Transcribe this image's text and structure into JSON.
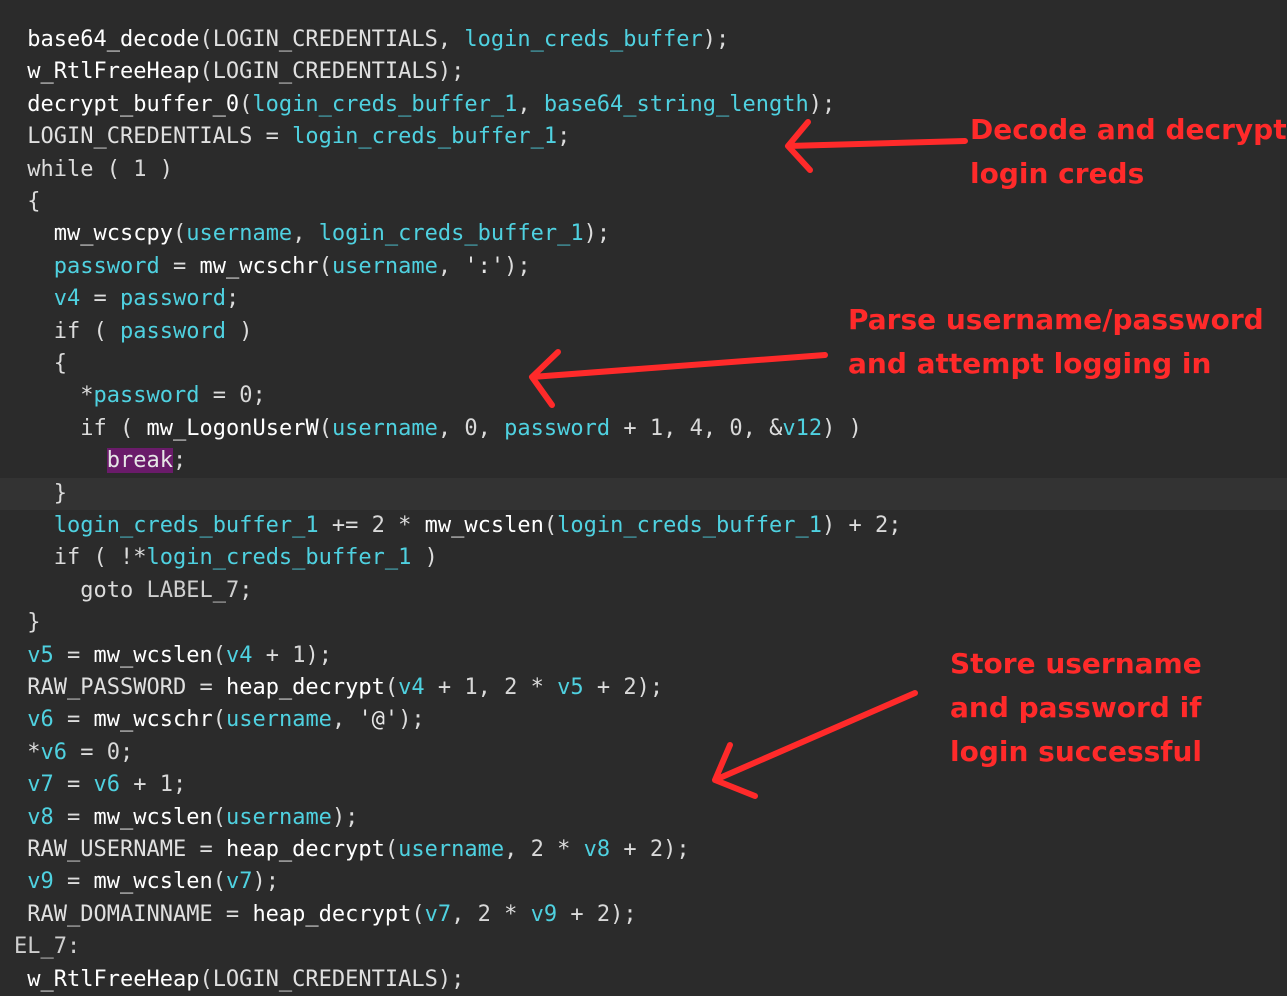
{
  "code_lines": [
    {
      "indent": 1,
      "tokens": [
        {
          "t": "base64_decode",
          "c": "fn"
        },
        {
          "t": "(",
          "c": "pn"
        },
        {
          "t": "LOGIN_CREDENTIALS",
          "c": "glob"
        },
        {
          "t": ", ",
          "c": "pn"
        },
        {
          "t": "login_creds_buffer",
          "c": "id"
        },
        {
          "t": ");",
          "c": "pn"
        }
      ]
    },
    {
      "indent": 1,
      "tokens": [
        {
          "t": "w_RtlFreeHeap",
          "c": "fn"
        },
        {
          "t": "(",
          "c": "pn"
        },
        {
          "t": "LOGIN_CREDENTIALS",
          "c": "glob"
        },
        {
          "t": ");",
          "c": "pn"
        }
      ]
    },
    {
      "indent": 1,
      "tokens": [
        {
          "t": "decrypt_buffer_0",
          "c": "fn"
        },
        {
          "t": "(",
          "c": "pn"
        },
        {
          "t": "login_creds_buffer_1",
          "c": "id"
        },
        {
          "t": ", ",
          "c": "pn"
        },
        {
          "t": "base64_string_length",
          "c": "id"
        },
        {
          "t": ");",
          "c": "pn"
        }
      ]
    },
    {
      "indent": 1,
      "tokens": [
        {
          "t": "LOGIN_CREDENTIALS",
          "c": "glob"
        },
        {
          "t": " = ",
          "c": "pn"
        },
        {
          "t": "login_creds_buffer_1",
          "c": "id"
        },
        {
          "t": ";",
          "c": "pn"
        }
      ]
    },
    {
      "indent": 1,
      "tokens": [
        {
          "t": "while",
          "c": "kw"
        },
        {
          "t": " ( ",
          "c": "pn"
        },
        {
          "t": "1",
          "c": "num"
        },
        {
          "t": " )",
          "c": "pn"
        }
      ]
    },
    {
      "indent": 1,
      "tokens": [
        {
          "t": "{",
          "c": "pn"
        }
      ]
    },
    {
      "indent": 3,
      "tokens": [
        {
          "t": "mw_wcscpy",
          "c": "fn"
        },
        {
          "t": "(",
          "c": "pn"
        },
        {
          "t": "username",
          "c": "id"
        },
        {
          "t": ", ",
          "c": "pn"
        },
        {
          "t": "login_creds_buffer_1",
          "c": "id"
        },
        {
          "t": ");",
          "c": "pn"
        }
      ]
    },
    {
      "indent": 3,
      "tokens": [
        {
          "t": "password",
          "c": "id"
        },
        {
          "t": " = ",
          "c": "pn"
        },
        {
          "t": "mw_wcschr",
          "c": "fn"
        },
        {
          "t": "(",
          "c": "pn"
        },
        {
          "t": "username",
          "c": "id"
        },
        {
          "t": ", ",
          "c": "pn"
        },
        {
          "t": "':'",
          "c": "str"
        },
        {
          "t": ");",
          "c": "pn"
        }
      ]
    },
    {
      "indent": 3,
      "tokens": [
        {
          "t": "v4",
          "c": "id"
        },
        {
          "t": " = ",
          "c": "pn"
        },
        {
          "t": "password",
          "c": "id"
        },
        {
          "t": ";",
          "c": "pn"
        }
      ]
    },
    {
      "indent": 3,
      "tokens": [
        {
          "t": "if",
          "c": "kw"
        },
        {
          "t": " ( ",
          "c": "pn"
        },
        {
          "t": "password",
          "c": "id"
        },
        {
          "t": " )",
          "c": "pn"
        }
      ]
    },
    {
      "indent": 3,
      "tokens": [
        {
          "t": "{",
          "c": "pn"
        }
      ]
    },
    {
      "indent": 5,
      "tokens": [
        {
          "t": "*",
          "c": "pn"
        },
        {
          "t": "password",
          "c": "id"
        },
        {
          "t": " = ",
          "c": "pn"
        },
        {
          "t": "0",
          "c": "num"
        },
        {
          "t": ";",
          "c": "pn"
        }
      ]
    },
    {
      "indent": 5,
      "tokens": [
        {
          "t": "if",
          "c": "kw"
        },
        {
          "t": " ( ",
          "c": "pn"
        },
        {
          "t": "mw_LogonUserW",
          "c": "fn"
        },
        {
          "t": "(",
          "c": "pn"
        },
        {
          "t": "username",
          "c": "id"
        },
        {
          "t": ", ",
          "c": "pn"
        },
        {
          "t": "0",
          "c": "num"
        },
        {
          "t": ", ",
          "c": "pn"
        },
        {
          "t": "password",
          "c": "id"
        },
        {
          "t": " + ",
          "c": "pn"
        },
        {
          "t": "1",
          "c": "num"
        },
        {
          "t": ", ",
          "c": "pn"
        },
        {
          "t": "4",
          "c": "num"
        },
        {
          "t": ", ",
          "c": "pn"
        },
        {
          "t": "0",
          "c": "num"
        },
        {
          "t": ", ",
          "c": "pn"
        },
        {
          "t": "&",
          "c": "pn"
        },
        {
          "t": "v12",
          "c": "id"
        },
        {
          "t": ") )",
          "c": "pn"
        }
      ]
    },
    {
      "indent": 7,
      "tokens": [
        {
          "t": "break",
          "c": "break"
        },
        {
          "t": ";",
          "c": "pn"
        }
      ]
    },
    {
      "indent": 3,
      "highlight": true,
      "tokens": [
        {
          "t": "}",
          "c": "pn"
        }
      ]
    },
    {
      "indent": 3,
      "tokens": [
        {
          "t": "login_creds_buffer_1",
          "c": "id"
        },
        {
          "t": " += ",
          "c": "pn"
        },
        {
          "t": "2",
          "c": "num"
        },
        {
          "t": " * ",
          "c": "pn"
        },
        {
          "t": "mw_wcslen",
          "c": "fn"
        },
        {
          "t": "(",
          "c": "pn"
        },
        {
          "t": "login_creds_buffer_1",
          "c": "id"
        },
        {
          "t": ") + ",
          "c": "pn"
        },
        {
          "t": "2",
          "c": "num"
        },
        {
          "t": ";",
          "c": "pn"
        }
      ]
    },
    {
      "indent": 3,
      "tokens": [
        {
          "t": "if",
          "c": "kw"
        },
        {
          "t": " ( !*",
          "c": "pn"
        },
        {
          "t": "login_creds_buffer_1",
          "c": "id"
        },
        {
          "t": " )",
          "c": "pn"
        }
      ]
    },
    {
      "indent": 5,
      "tokens": [
        {
          "t": "goto",
          "c": "kw"
        },
        {
          "t": " ",
          "c": "pn"
        },
        {
          "t": "LABEL_7",
          "c": "label"
        },
        {
          "t": ";",
          "c": "pn"
        }
      ]
    },
    {
      "indent": 1,
      "tokens": [
        {
          "t": "}",
          "c": "pn"
        }
      ]
    },
    {
      "indent": 1,
      "tokens": [
        {
          "t": "v5",
          "c": "id"
        },
        {
          "t": " = ",
          "c": "pn"
        },
        {
          "t": "mw_wcslen",
          "c": "fn"
        },
        {
          "t": "(",
          "c": "pn"
        },
        {
          "t": "v4",
          "c": "id"
        },
        {
          "t": " + ",
          "c": "pn"
        },
        {
          "t": "1",
          "c": "num"
        },
        {
          "t": ");",
          "c": "pn"
        }
      ]
    },
    {
      "indent": 1,
      "tokens": [
        {
          "t": "RAW_PASSWORD",
          "c": "glob"
        },
        {
          "t": " = ",
          "c": "pn"
        },
        {
          "t": "heap_decrypt",
          "c": "fn"
        },
        {
          "t": "(",
          "c": "pn"
        },
        {
          "t": "v4",
          "c": "id"
        },
        {
          "t": " + ",
          "c": "pn"
        },
        {
          "t": "1",
          "c": "num"
        },
        {
          "t": ", ",
          "c": "pn"
        },
        {
          "t": "2",
          "c": "num"
        },
        {
          "t": " * ",
          "c": "pn"
        },
        {
          "t": "v5",
          "c": "id"
        },
        {
          "t": " + ",
          "c": "pn"
        },
        {
          "t": "2",
          "c": "num"
        },
        {
          "t": ");",
          "c": "pn"
        }
      ]
    },
    {
      "indent": 1,
      "tokens": [
        {
          "t": "v6",
          "c": "id"
        },
        {
          "t": " = ",
          "c": "pn"
        },
        {
          "t": "mw_wcschr",
          "c": "fn"
        },
        {
          "t": "(",
          "c": "pn"
        },
        {
          "t": "username",
          "c": "id"
        },
        {
          "t": ", ",
          "c": "pn"
        },
        {
          "t": "'@'",
          "c": "str"
        },
        {
          "t": ");",
          "c": "pn"
        }
      ]
    },
    {
      "indent": 1,
      "tokens": [
        {
          "t": "*",
          "c": "pn"
        },
        {
          "t": "v6",
          "c": "id"
        },
        {
          "t": " = ",
          "c": "pn"
        },
        {
          "t": "0",
          "c": "num"
        },
        {
          "t": ";",
          "c": "pn"
        }
      ]
    },
    {
      "indent": 1,
      "tokens": [
        {
          "t": "v7",
          "c": "id"
        },
        {
          "t": " = ",
          "c": "pn"
        },
        {
          "t": "v6",
          "c": "id"
        },
        {
          "t": " + ",
          "c": "pn"
        },
        {
          "t": "1",
          "c": "num"
        },
        {
          "t": ";",
          "c": "pn"
        }
      ]
    },
    {
      "indent": 1,
      "tokens": [
        {
          "t": "v8",
          "c": "id"
        },
        {
          "t": " = ",
          "c": "pn"
        },
        {
          "t": "mw_wcslen",
          "c": "fn"
        },
        {
          "t": "(",
          "c": "pn"
        },
        {
          "t": "username",
          "c": "id"
        },
        {
          "t": ");",
          "c": "pn"
        }
      ]
    },
    {
      "indent": 1,
      "tokens": [
        {
          "t": "RAW_USERNAME",
          "c": "glob"
        },
        {
          "t": " = ",
          "c": "pn"
        },
        {
          "t": "heap_decrypt",
          "c": "fn"
        },
        {
          "t": "(",
          "c": "pn"
        },
        {
          "t": "username",
          "c": "id"
        },
        {
          "t": ", ",
          "c": "pn"
        },
        {
          "t": "2",
          "c": "num"
        },
        {
          "t": " * ",
          "c": "pn"
        },
        {
          "t": "v8",
          "c": "id"
        },
        {
          "t": " + ",
          "c": "pn"
        },
        {
          "t": "2",
          "c": "num"
        },
        {
          "t": ");",
          "c": "pn"
        }
      ]
    },
    {
      "indent": 1,
      "tokens": [
        {
          "t": "v9",
          "c": "id"
        },
        {
          "t": " = ",
          "c": "pn"
        },
        {
          "t": "mw_wcslen",
          "c": "fn"
        },
        {
          "t": "(",
          "c": "pn"
        },
        {
          "t": "v7",
          "c": "id"
        },
        {
          "t": ");",
          "c": "pn"
        }
      ]
    },
    {
      "indent": 1,
      "tokens": [
        {
          "t": "RAW_DOMAINNAME",
          "c": "glob"
        },
        {
          "t": " = ",
          "c": "pn"
        },
        {
          "t": "heap_decrypt",
          "c": "fn"
        },
        {
          "t": "(",
          "c": "pn"
        },
        {
          "t": "v7",
          "c": "id"
        },
        {
          "t": ", ",
          "c": "pn"
        },
        {
          "t": "2",
          "c": "num"
        },
        {
          "t": " * ",
          "c": "pn"
        },
        {
          "t": "v9",
          "c": "id"
        },
        {
          "t": " + ",
          "c": "pn"
        },
        {
          "t": "2",
          "c": "num"
        },
        {
          "t": ");",
          "c": "pn"
        }
      ]
    },
    {
      "indent": 0,
      "tokens": [
        {
          "t": "EL_7:",
          "c": "label"
        }
      ]
    },
    {
      "indent": 1,
      "tokens": [
        {
          "t": "w_RtlFreeHeap",
          "c": "fn"
        },
        {
          "t": "(",
          "c": "pn"
        },
        {
          "t": "LOGIN_CREDENTIALS",
          "c": "glob"
        },
        {
          "t": ");",
          "c": "pn"
        }
      ]
    }
  ],
  "annotations": {
    "decode": "Decode and decrypt\nlogin creds",
    "parse": "Parse username/password\nand attempt logging in",
    "store": "Store username\nand password if\nlogin successful"
  },
  "colors": {
    "background": "#2b2b2b",
    "identifier": "#4fd1e0",
    "annotation": "#ff2a2a",
    "break_highlight": "#6a1b6a"
  }
}
